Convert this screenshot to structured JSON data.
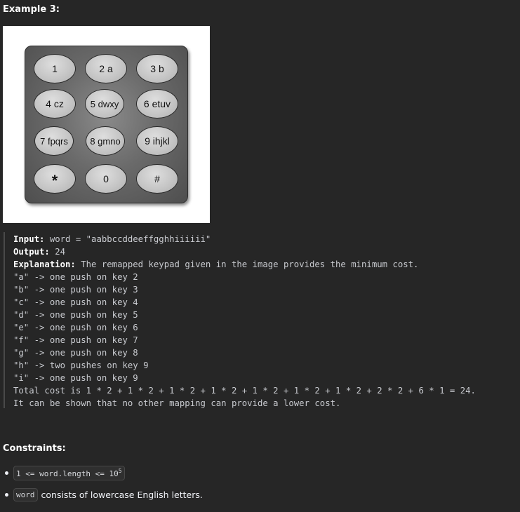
{
  "example": {
    "heading": "Example 3:",
    "keypad": {
      "keys": [
        "1",
        "2 a",
        "3 b",
        "4 cz",
        "5 dwxy",
        "6 etuv",
        "7 fpqrs",
        "8 gmno",
        "9 ihjkl",
        "*",
        "0",
        "#"
      ]
    },
    "input_label": "Input:",
    "input_value": " word = \"aabbccddeeffgghhiiiiii\"",
    "output_label": "Output:",
    "output_value": " 24",
    "explanation_label": "Explanation:",
    "explanation_value": " The remapped keypad given in the image provides the minimum cost.",
    "lines": [
      "\"a\" -> one push on key 2",
      "\"b\" -> one push on key 3",
      "\"c\" -> one push on key 4",
      "\"d\" -> one push on key 5",
      "\"e\" -> one push on key 6",
      "\"f\" -> one push on key 7",
      "\"g\" -> one push on key 8",
      "\"h\" -> two pushes on key 9",
      "\"i\" -> one push on key 9",
      "Total cost is 1 * 2 + 1 * 2 + 1 * 2 + 1 * 2 + 1 * 2 + 1 * 2 + 1 * 2 + 2 * 2 + 6 * 1 = 24.",
      "It can be shown that no other mapping can provide a lower cost."
    ]
  },
  "constraints": {
    "heading": "Constraints:",
    "item1_code": "1 <= word.length <= 10",
    "item1_sup": "5",
    "item2_code": "word",
    "item2_text": "consists of lowercase English letters."
  }
}
